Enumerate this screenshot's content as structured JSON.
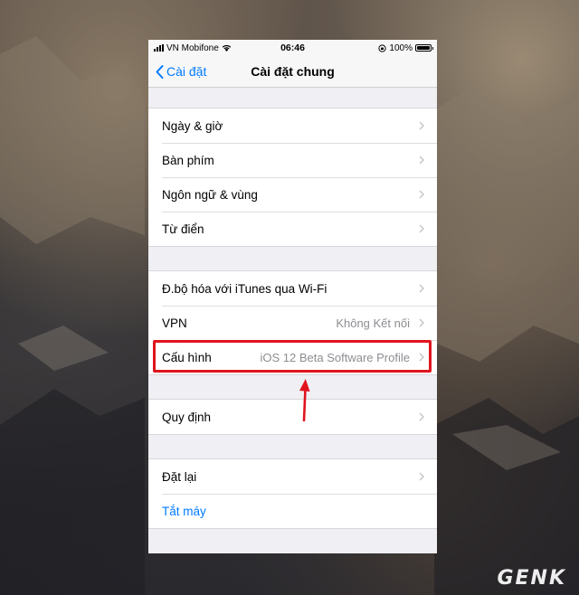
{
  "status_bar": {
    "carrier": "VN Mobifone",
    "time": "06:46",
    "battery": "100%",
    "battery_level": 1.0
  },
  "nav": {
    "back_label": "Cài đặt",
    "title": "Cài đặt chung"
  },
  "groups": [
    {
      "rows": [
        {
          "label": "Ngày & giờ"
        },
        {
          "label": "Bàn phím"
        },
        {
          "label": "Ngôn ngữ & vùng"
        },
        {
          "label": "Từ điển"
        }
      ]
    },
    {
      "rows": [
        {
          "label": "Đ.bộ hóa với iTunes qua Wi-Fi"
        },
        {
          "label": "VPN",
          "value": "Không Kết nối"
        },
        {
          "label": "Cấu hình",
          "value": "iOS 12 Beta Software Profile"
        }
      ]
    },
    {
      "rows": [
        {
          "label": "Quy định"
        }
      ]
    },
    {
      "rows": [
        {
          "label": "Đặt lại"
        },
        {
          "label": "Tắt máy"
        }
      ]
    }
  ],
  "watermark": "GENK",
  "colors": {
    "accent": "#007aff",
    "highlight": "#e0141e"
  }
}
